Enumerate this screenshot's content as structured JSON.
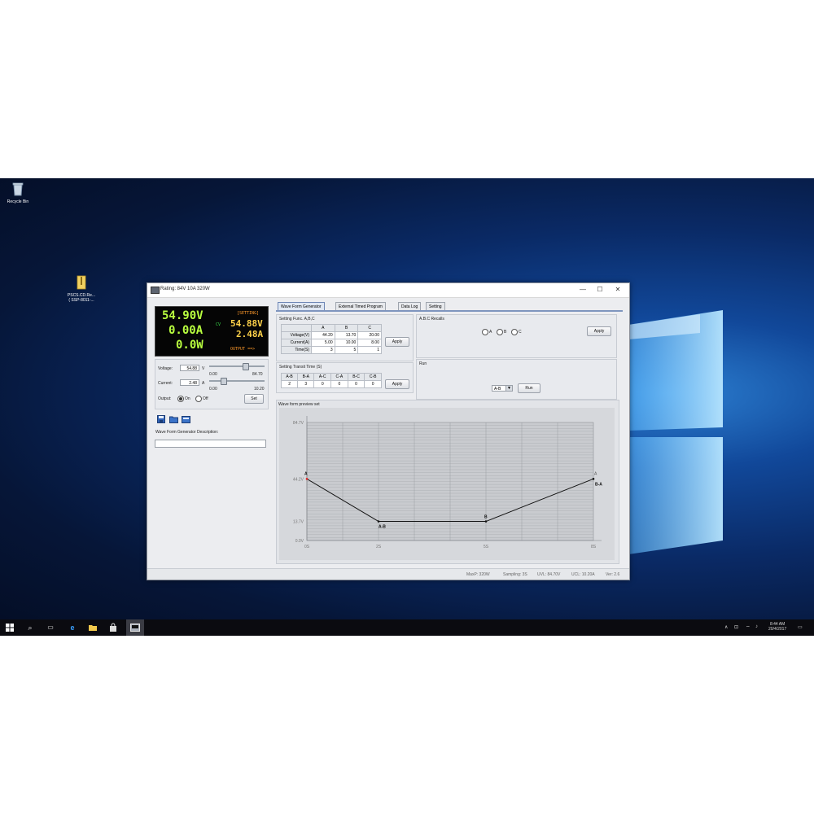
{
  "desktop": {
    "icons": [
      {
        "label": "Recycle Bin",
        "icon": "recycle-bin-icon"
      },
      {
        "label": "PSCS.CD.Re...\n( SSP-8011-...",
        "icon": "zip-file-icon"
      }
    ]
  },
  "window": {
    "title": "Rating: 84V 10A 320W",
    "controls": {
      "minimize": "—",
      "maximize": "☐",
      "close": "✕"
    }
  },
  "lcd": {
    "voltage": "54.90V",
    "current": "0.00A",
    "power": "0.0W",
    "setting_tag": "[SETTING]",
    "mode": "CV",
    "set_voltage": "54.88V",
    "set_current": "2.48A",
    "output_tag": "OUTPUT ==>"
  },
  "controls": {
    "voltage_label": "Voltage:",
    "voltage_value": "54.88",
    "voltage_unit": "V",
    "voltage_min": "0.00",
    "voltage_max": "84.70",
    "voltage_slider_fraction": 0.648,
    "current_label": "Current:",
    "current_value": "2.48",
    "current_unit": "A",
    "current_min": "0.00",
    "current_max": "10.20",
    "current_slider_fraction": 0.243,
    "output_label": "Output:",
    "output_on": "On",
    "output_off": "Off",
    "output_selected": "On",
    "set_button": "Set",
    "toolbar_icons": [
      "save-icon",
      "open-folder-icon",
      "export-icon"
    ],
    "description_label": "Wave Form Generator Description:",
    "description_value": ""
  },
  "tabs": [
    {
      "label": "Wave Form Generator",
      "active": true
    },
    {
      "label": "External Timed Program",
      "active": false
    },
    {
      "label": "Data Log",
      "active": false
    },
    {
      "label": "Setting",
      "active": false
    }
  ],
  "setting_func": {
    "title": "Setting Func. A,B,C",
    "columns": [
      "",
      "A",
      "B",
      "C"
    ],
    "rows": [
      {
        "label": "Voltage(V)",
        "values": [
          "44.20",
          "13.70",
          "20.00"
        ]
      },
      {
        "label": "Current(A)",
        "values": [
          "5.00",
          "10.00",
          "8.00"
        ]
      },
      {
        "label": "Time(S)",
        "values": [
          "3",
          "5",
          "1"
        ]
      }
    ],
    "apply": "Apply"
  },
  "transit": {
    "title": "Setting Transit Time (S)",
    "columns": [
      "A-B",
      "B-A",
      "A-C",
      "C-A",
      "B-C",
      "C-B"
    ],
    "values": [
      "2",
      "3",
      "0",
      "0",
      "0",
      "0"
    ],
    "apply": "Apply"
  },
  "recalls": {
    "title": "A.B.C Recalls",
    "options": [
      "A",
      "B",
      "C"
    ],
    "apply": "Apply"
  },
  "run": {
    "title": "Run",
    "selected": "A-B",
    "button": "Run"
  },
  "preview": {
    "title": "Wave form preview set"
  },
  "chart_data": {
    "type": "line",
    "y_ticks": [
      "84.7V",
      "44.2V",
      "13.7V",
      "0.0V"
    ],
    "y_tick_values": [
      84.7,
      44.2,
      13.7,
      0.0
    ],
    "x_ticks": [
      "0S",
      "2S",
      "5S",
      "8S"
    ],
    "x_tick_values": [
      0,
      2,
      5,
      8
    ],
    "xlim": [
      0,
      8
    ],
    "ylim": [
      0,
      84.7
    ],
    "points": [
      {
        "x": 0,
        "y": 44.2,
        "label": "A"
      },
      {
        "x": 2,
        "y": 13.7,
        "label": "A-B"
      },
      {
        "x": 5,
        "y": 13.7,
        "label": "B"
      },
      {
        "x": 8,
        "y": 44.2,
        "label": "B-A"
      }
    ],
    "end_label": "A",
    "grid": true
  },
  "status_bar": {
    "items": [
      "MaxP: 320W",
      "Sampling: 3S",
      "UVL: 84.70V",
      "UCL: 10.20A",
      "Ver: 2.6"
    ]
  },
  "taskbar": {
    "icons": [
      "windows-start-icon",
      "search-icon",
      "task-view-icon",
      "edge-icon",
      "file-explorer-icon",
      "store-icon",
      "app-icon"
    ],
    "time": "8:44 AM",
    "date": "20/4/2017"
  }
}
